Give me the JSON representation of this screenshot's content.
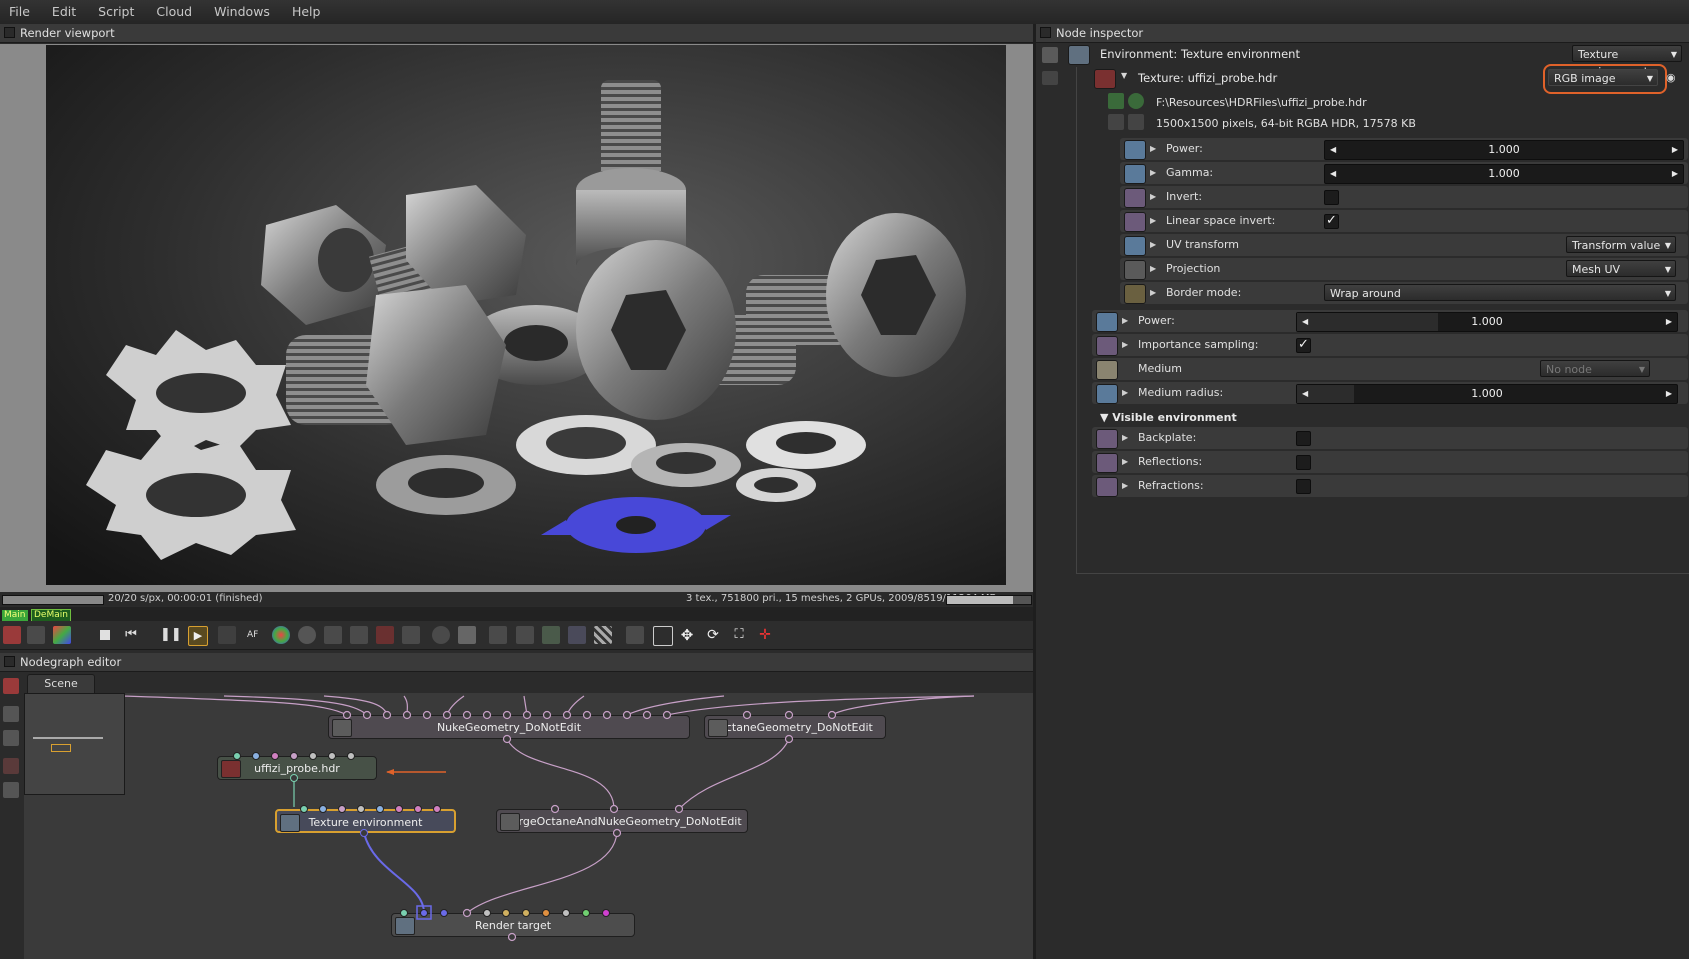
{
  "menu": [
    "File",
    "Edit",
    "Script",
    "Cloud",
    "Windows",
    "Help"
  ],
  "viewport": {
    "title": "Render viewport",
    "status_left": "20/20 s/px, 00:00:01 (finished)",
    "status_right": "3 tex., 751800 pri., 15 meshes, 2 GPUs, 2009/8519/11264 MB",
    "progress": 1.0,
    "tab_main": "Main",
    "tab_demain": "DeMain"
  },
  "inspector": {
    "title": "Node inspector",
    "environment_label": "Environment: Texture environment",
    "environment_type": "Texture environment",
    "texture_label": "Texture: uffizi_probe.hdr",
    "texture_type": "RGB image",
    "file_path": "F:\\Resources\\HDRFiles\\uffizi_probe.hdr",
    "file_info": "1500x1500 pixels, 64-bit RGBA HDR, 17578 KB",
    "tex_params": {
      "power_label": "Power:",
      "power_value": "1.000",
      "gamma_label": "Gamma:",
      "gamma_value": "1.000",
      "invert_label": "Invert:",
      "invert_checked": false,
      "linear_label": "Linear space invert:",
      "linear_checked": true,
      "uv_label": "UV transform",
      "uv_value": "Transform value",
      "projection_label": "Projection",
      "projection_value": "Mesh UV",
      "border_label": "Border mode:",
      "border_value": "Wrap around"
    },
    "env_params": {
      "power_label": "Power:",
      "power_value": "1.000",
      "importance_label": "Importance sampling:",
      "importance_checked": true,
      "medium_label": "Medium",
      "medium_value": "No node",
      "medium_radius_label": "Medium radius:",
      "medium_radius_value": "1.000"
    },
    "visible_env": {
      "section_label": "Visible environment",
      "backplate_label": "Backplate:",
      "reflections_label": "Reflections:",
      "refractions_label": "Refractions:"
    }
  },
  "nodegraph": {
    "title": "Nodegraph editor",
    "tab": "Scene",
    "nodes": {
      "nuke": "NukeGeometry_DoNotEdit",
      "octane": "OctaneGeometry_DoNotEdit",
      "uffizi": "uffizi_probe.hdr",
      "texenv": "Texture environment",
      "merge": "MergeOctaneAndNukeGeometry_DoNotEdit",
      "render": "Render target"
    }
  },
  "colors": {
    "highlight": "#e0622a",
    "selected_node": "#d8a030",
    "render_accent": "#4848d8"
  }
}
